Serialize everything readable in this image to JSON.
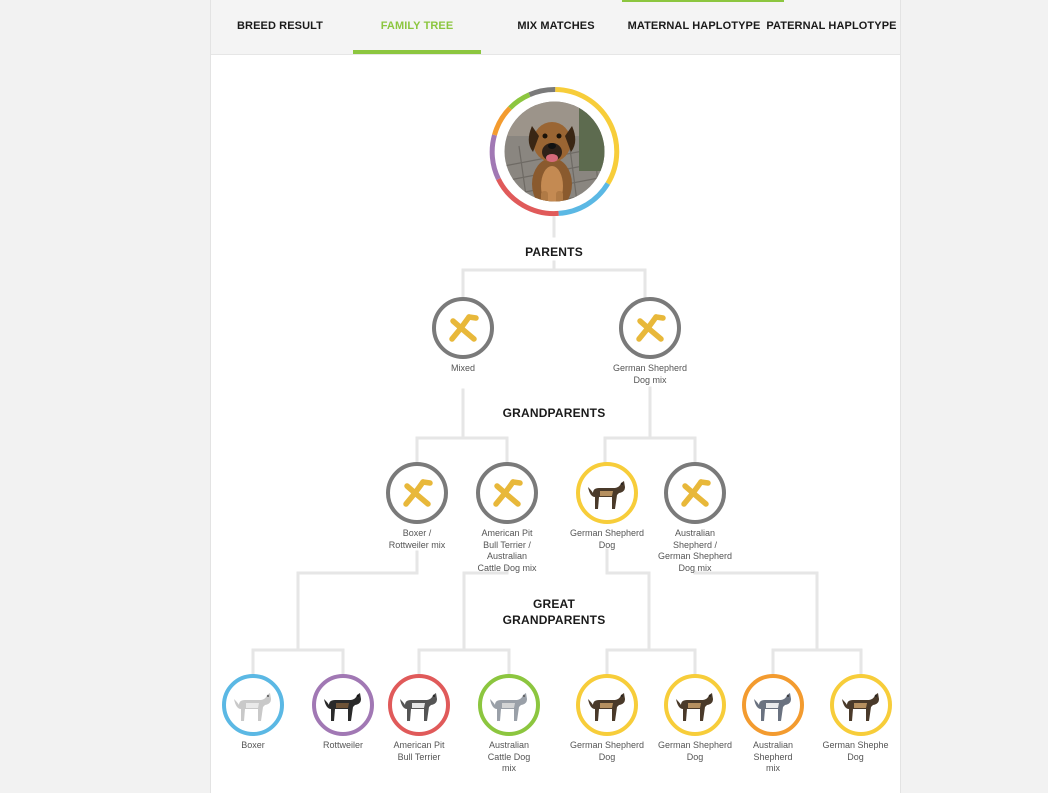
{
  "tabs": [
    {
      "label": "BREED RESULT",
      "active": false
    },
    {
      "label": "FAMILY TREE",
      "active": true
    },
    {
      "label": "MIX MATCHES",
      "active": false
    },
    {
      "label": "MATERNAL HAPLOTYPE",
      "active": false
    },
    {
      "label": "PATERNAL HAPLOTYPE",
      "active": false
    }
  ],
  "colors": {
    "accent": "#8cc63f",
    "mixed": "#7a7a7a",
    "boxer": "#5bb8e4",
    "rottweiler": "#a178b4",
    "pitbull": "#e05a5a",
    "cattle_dog": "#8cc63f",
    "german_shepherd": "#f7cd3a",
    "aussie": "#f39b2f",
    "mix_icon": "#e8b83a"
  },
  "tree": {
    "headings": {
      "parents": "PARENTS",
      "grandparents": "GRANDPARENTS",
      "great_grandparents_line1": "GREAT",
      "great_grandparents_line2": "GRANDPARENTS"
    },
    "parents": [
      {
        "label_lines": [
          "Mixed"
        ],
        "icon": "mix-icon",
        "color": "mixed"
      },
      {
        "label_lines": [
          "German Shepherd",
          "Dog mix"
        ],
        "icon": "mix-icon",
        "color": "mixed"
      }
    ],
    "grandparents": [
      {
        "label_lines": [
          "Boxer /",
          "Rottweiler mix"
        ],
        "icon": "mix-icon",
        "color": "mixed"
      },
      {
        "label_lines": [
          "American Pit",
          "Bull Terrier /",
          "Australian",
          "Cattle Dog mix"
        ],
        "icon": "mix-icon",
        "color": "mixed"
      },
      {
        "label_lines": [
          "German Shepherd",
          "Dog"
        ],
        "icon": "german-shepherd-icon",
        "color": "german_shepherd"
      },
      {
        "label_lines": [
          "Australian",
          "Shepherd /",
          "German Shepherd",
          "Dog mix"
        ],
        "icon": "mix-icon",
        "color": "mixed"
      }
    ],
    "great_grandparents": [
      {
        "label_lines": [
          "Boxer"
        ],
        "icon": "boxer-icon",
        "color": "boxer"
      },
      {
        "label_lines": [
          "Rottweiler"
        ],
        "icon": "rottweiler-icon",
        "color": "rottweiler"
      },
      {
        "label_lines": [
          "American Pit",
          "Bull Terrier"
        ],
        "icon": "pitbull-icon",
        "color": "pitbull"
      },
      {
        "label_lines": [
          "Australian",
          "Cattle Dog",
          "mix"
        ],
        "icon": "cattle-dog-icon",
        "color": "cattle_dog"
      },
      {
        "label_lines": [
          "German Shepherd",
          "Dog"
        ],
        "icon": "german-shepherd-icon",
        "color": "german_shepherd"
      },
      {
        "label_lines": [
          "German Shepherd",
          "Dog"
        ],
        "icon": "german-shepherd-icon",
        "color": "german_shepherd"
      },
      {
        "label_lines": [
          "Australian",
          "Shepherd",
          "mix"
        ],
        "icon": "australian-shepherd-icon",
        "color": "aussie"
      },
      {
        "label_lines": [
          "German Shephe",
          "Dog"
        ],
        "icon": "german-shepherd-icon",
        "color": "german_shepherd"
      }
    ]
  },
  "main_dog": {
    "icon": "dog-photo",
    "ring_colors": [
      "#f7cd3a",
      "#5bb8e4",
      "#e05a5a",
      "#a178b4",
      "#f39b2f",
      "#8cc63f",
      "#7a7a7a"
    ]
  }
}
